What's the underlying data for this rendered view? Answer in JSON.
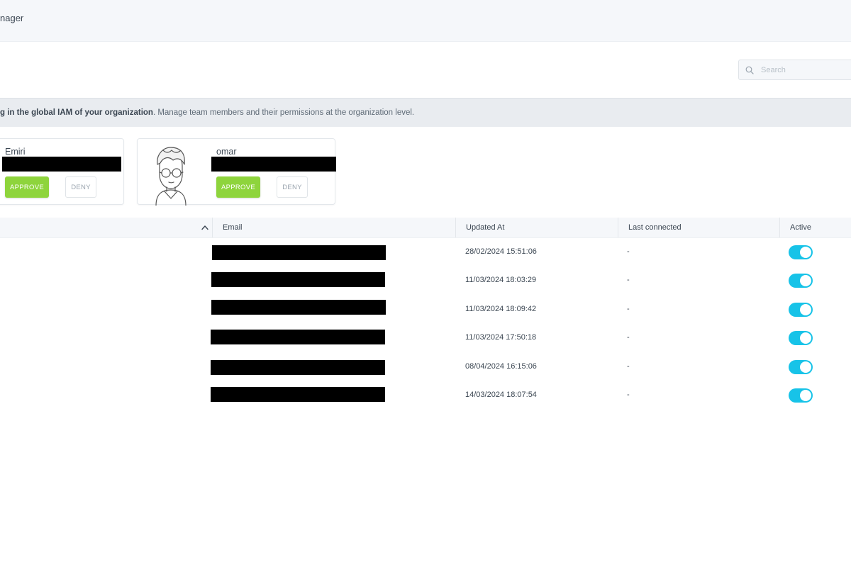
{
  "header": {
    "title": "nager"
  },
  "search": {
    "placeholder": "Search",
    "value": ""
  },
  "banner": {
    "bold_text": "g in the global IAM of your organization",
    "rest_text": ". Manage team members and their permissions at the organization level."
  },
  "pending_requests": [
    {
      "name": "Emiri",
      "approve_label": "APPROVE",
      "deny_label": "DENY",
      "avatar": "none"
    },
    {
      "name": "omar",
      "approve_label": "APPROVE",
      "deny_label": "DENY",
      "avatar": "cartoon-avatar-with-glasses"
    }
  ],
  "table": {
    "columns": [
      "Email",
      "Updated At",
      "Last connected",
      "Active"
    ],
    "sort_icon": "chevron-up-icon",
    "rows": [
      {
        "updated_at": "28/02/2024 15:51:06",
        "last_connected": "-",
        "active": true
      },
      {
        "updated_at": "11/03/2024 18:03:29",
        "last_connected": "-",
        "active": true
      },
      {
        "updated_at": "11/03/2024 18:09:42",
        "last_connected": "-",
        "active": true
      },
      {
        "updated_at": "11/03/2024 17:50:18",
        "last_connected": "-",
        "active": true
      },
      {
        "updated_at": "08/04/2024 16:15:06",
        "last_connected": "-",
        "active": true
      },
      {
        "updated_at": "14/03/2024 18:07:54",
        "last_connected": "-",
        "active": true
      }
    ]
  },
  "colors": {
    "approve": "#8ed43c",
    "toggle_on": "#17c3e8",
    "banner_bg": "#e9ecf0",
    "header_bg": "#f5f7fa"
  }
}
